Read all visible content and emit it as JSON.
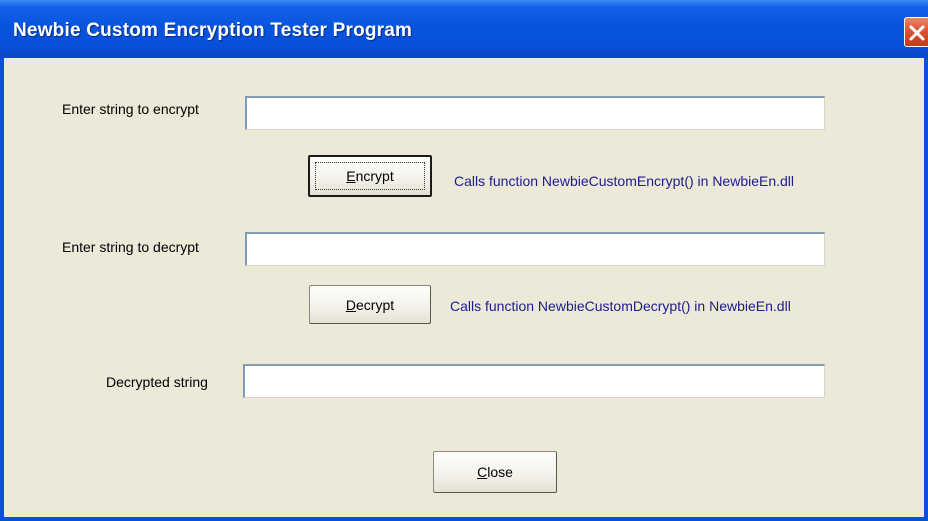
{
  "window": {
    "title": "Newbie Custom Encryption Tester Program"
  },
  "encrypt": {
    "label": "Enter string to encrypt",
    "value": "",
    "button_mnemonic": "E",
    "button_rest": "ncrypt",
    "note": "Calls function NewbieCustomEncrypt() in NewbieEn.dll"
  },
  "decrypt": {
    "label": "Enter string to decrypt",
    "value": "",
    "button_mnemonic": "D",
    "button_rest": "ecrypt",
    "note": "Calls function NewbieCustomDecrypt() in NewbieEn.dll"
  },
  "result": {
    "label": "Decrypted string",
    "value": ""
  },
  "close": {
    "button_mnemonic": "C",
    "button_rest": "lose"
  },
  "icons": {
    "title_close": "close-icon"
  },
  "colors": {
    "titlebar": "#0a4fd8",
    "window_bg": "#ece9d8",
    "note_text": "#1c1c8c",
    "close_button": "#d8512f"
  }
}
